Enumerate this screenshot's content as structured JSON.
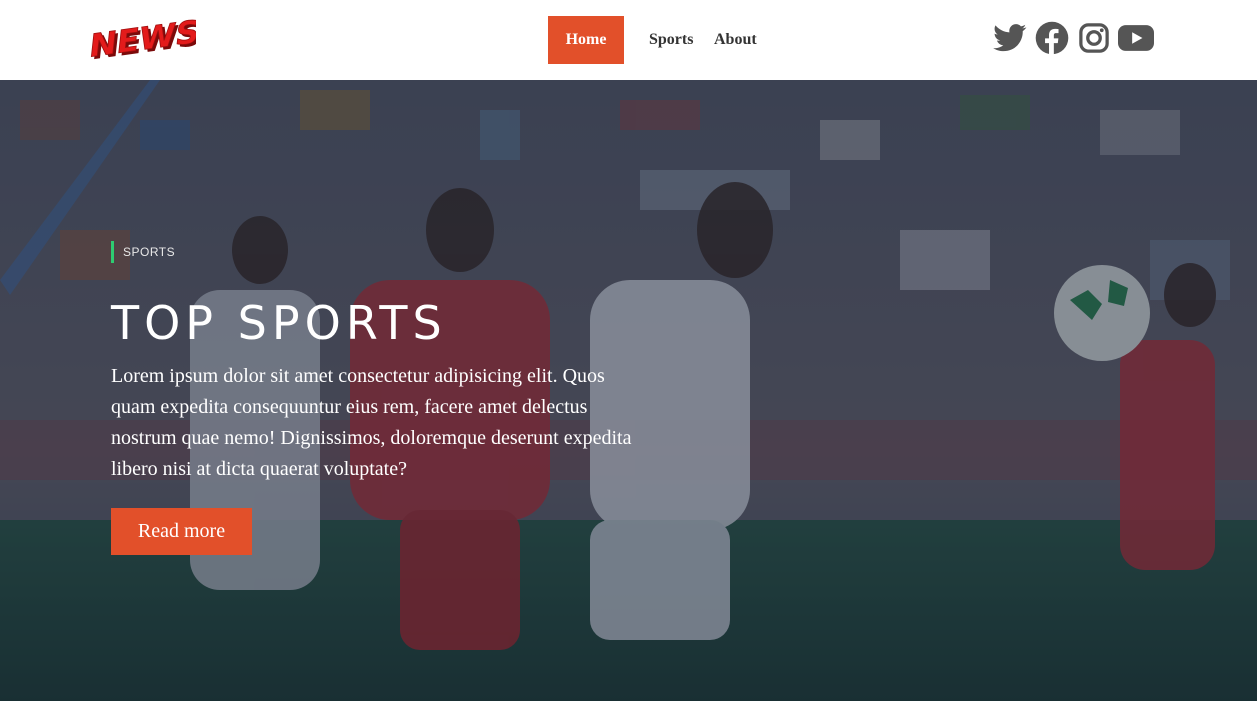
{
  "header": {
    "logo_text": "NEWS",
    "nav": [
      {
        "label": "Home",
        "active": true
      },
      {
        "label": "Sports",
        "active": false
      },
      {
        "label": "About",
        "active": false
      }
    ],
    "social_icons": [
      "twitter-icon",
      "facebook-icon",
      "instagram-icon",
      "youtube-icon"
    ]
  },
  "hero": {
    "category": "SPORTS",
    "title": "TOP SPORTS",
    "text": "Lorem ipsum dolor sit amet consectetur adipisicing elit. Quos quam expedita consequuntur eius rem, facere amet delectus nostrum quae nemo! Dignissimos, doloremque deserunt expedita libero nisi at dicta quaerat voluptate?",
    "button_label": "Read more"
  },
  "colors": {
    "accent": "#e2502a",
    "category_bar": "#2ecc71",
    "logo_red": "#e31b1b",
    "icon_gray": "#555555"
  }
}
